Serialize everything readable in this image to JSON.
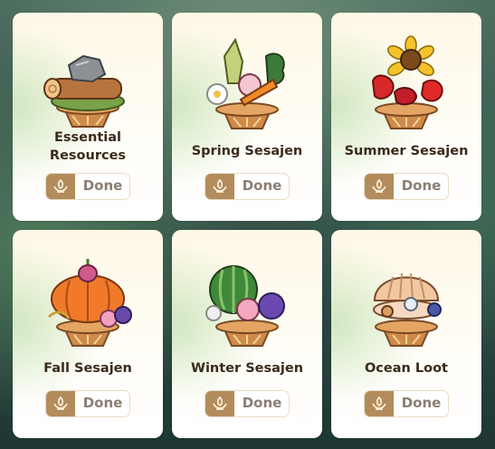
{
  "cards": [
    {
      "title": "Essential\nResources",
      "status": "Done",
      "art_icon": "logs-rock-offering-icon"
    },
    {
      "title": "Spring Sesajen",
      "status": "Done",
      "art_icon": "spring-vegetables-offering-icon"
    },
    {
      "title": "Summer Sesajen",
      "status": "Done",
      "art_icon": "sunflower-peppers-offering-icon"
    },
    {
      "title": "Fall Sesajen",
      "status": "Done",
      "art_icon": "pumpkin-offering-icon"
    },
    {
      "title": "Winter Sesajen",
      "status": "Done",
      "art_icon": "watermelon-flowers-offering-icon"
    },
    {
      "title": "Ocean Loot",
      "status": "Done",
      "art_icon": "pearl-shell-offering-icon"
    }
  ],
  "status_icon": "offering-bowl-icon"
}
